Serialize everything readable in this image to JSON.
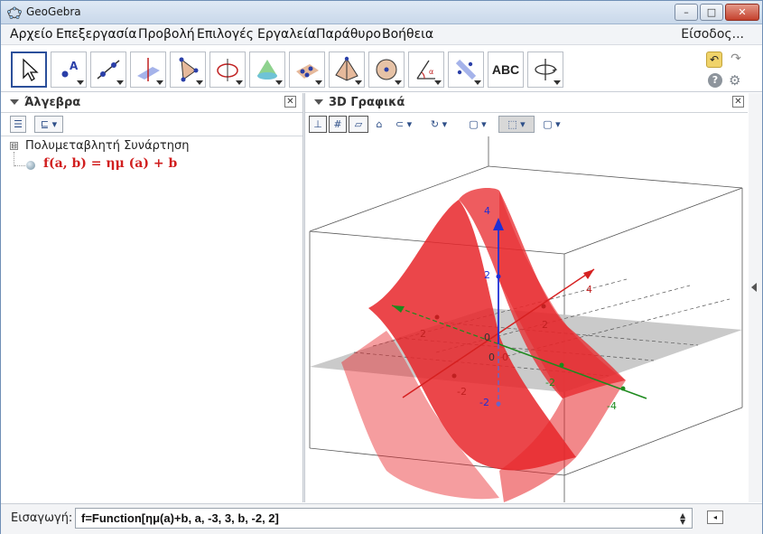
{
  "window": {
    "title": "GeoGebra",
    "minimize_label": "–",
    "maximize_label": "□",
    "close_label": "✕"
  },
  "menu": {
    "items": [
      {
        "label": "Αρχείο"
      },
      {
        "label": "Επεξεργασία"
      },
      {
        "label": "Προβολή"
      },
      {
        "label": "Επιλογές"
      },
      {
        "label": "Εργαλεία"
      },
      {
        "label": "Παράθυρο"
      },
      {
        "label": "Βοήθεια"
      }
    ],
    "login": "Είσοδος..."
  },
  "toolbar": {
    "tools": [
      {
        "icon": "move-arrow-icon",
        "selected": true
      },
      {
        "icon": "point-icon"
      },
      {
        "icon": "line-through-two-points-icon"
      },
      {
        "icon": "perpendicular-line-icon"
      },
      {
        "icon": "polygon-icon"
      },
      {
        "icon": "circle-around-line-icon"
      },
      {
        "icon": "intersect-surfaces-icon"
      },
      {
        "icon": "plane-through-three-points-icon"
      },
      {
        "icon": "pyramid-icon"
      },
      {
        "icon": "sphere-icon"
      },
      {
        "icon": "angle-icon"
      },
      {
        "icon": "reflect-about-plane-icon"
      },
      {
        "icon": "text-icon",
        "label": "ABC"
      },
      {
        "icon": "rotate-3d-view-icon"
      }
    ],
    "undo_icon": "undo-icon",
    "redo_icon": "redo-icon",
    "help_label": "?",
    "settings_icon": "gear-icon"
  },
  "algebra": {
    "title": "Άλγεβρα",
    "category": "Πολυμεταβλητή Συνάρτηση",
    "toggle": "⊟",
    "object": {
      "definition": "f(a, b)  =  ημ (a) + b",
      "color": "#d11f1f"
    }
  },
  "graphics": {
    "title": "3D Γραφικά",
    "surface_color": "#e8262a",
    "plane_color": "#c4c4c4",
    "axes": {
      "x_color": "#d62020",
      "y_color": "#1d8a1d",
      "z_color": "#1f2fd6"
    },
    "labels": {
      "x_ticks": [
        "4",
        "2",
        "-2"
      ],
      "y_ticks": [
        "-2",
        "-4"
      ],
      "z_ticks": [
        "4",
        "2",
        "0",
        "-2"
      ],
      "origin_x": "0"
    }
  },
  "input": {
    "label": "Εισαγωγή:",
    "value": "f=Function[ημ(a)+b, a, -3, 3, b, -2, 2]"
  }
}
